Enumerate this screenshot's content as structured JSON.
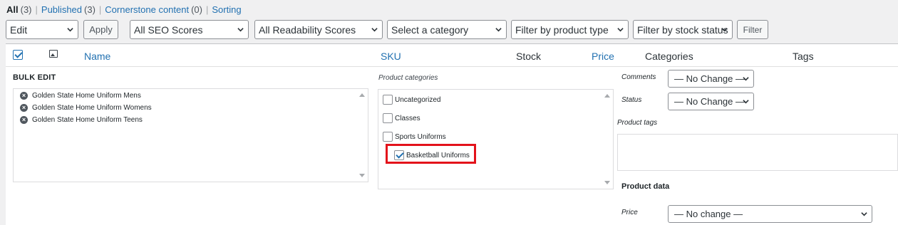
{
  "views": [
    {
      "label": "All",
      "count": "(3)",
      "current": true
    },
    {
      "label": "Published",
      "count": "(3)"
    },
    {
      "label": "Cornerstone content",
      "count": "(0)"
    },
    {
      "label": "Sorting",
      "count": ""
    }
  ],
  "toolbar": {
    "bulk_action": "Edit",
    "apply": "Apply",
    "seo_filter": "All SEO Scores",
    "readability_filter": "All Readability Scores",
    "category_filter": "Select a category",
    "product_type_filter": "Filter by product type",
    "stock_filter": "Filter by stock status",
    "filter_button": "Filter"
  },
  "columns": {
    "name": "Name",
    "sku": "SKU",
    "stock": "Stock",
    "price": "Price",
    "categories": "Categories",
    "tags": "Tags"
  },
  "bulk_edit": {
    "title": "BULK EDIT",
    "items": [
      "Golden State Home Uniform Mens",
      "Golden State Home Uniform Womens",
      "Golden State Home Uniform Teens"
    ],
    "categories_label": "Product categories",
    "categories": [
      {
        "label": "Uncategorized",
        "checked": false
      },
      {
        "label": "Classes",
        "checked": false
      },
      {
        "label": "Sports Uniforms",
        "checked": false
      },
      {
        "label": "Basketball Uniforms",
        "checked": true,
        "child": true
      }
    ],
    "comments_label": "Comments",
    "comments_value": "— No Change —",
    "status_label": "Status",
    "status_value": "— No Change —",
    "tags_label": "Product tags",
    "product_data_label": "Product data",
    "price_label": "Price",
    "price_value": "— No change —"
  },
  "colors": {
    "link": "#2271b1",
    "highlight": "#e3121b"
  }
}
